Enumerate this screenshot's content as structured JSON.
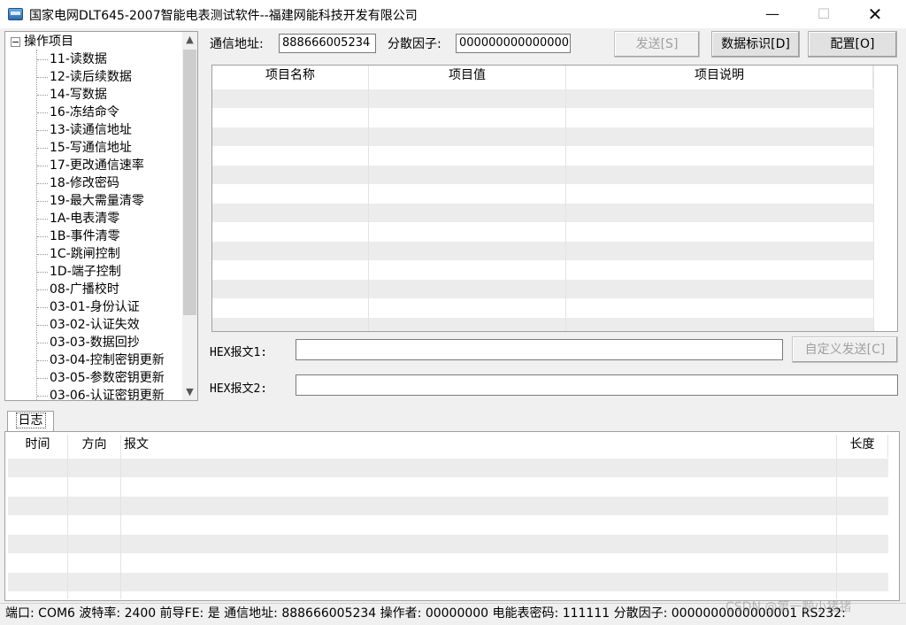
{
  "window": {
    "title": "国家电网DLT645-2007智能电表测试软件--福建网能科技开发有限公司",
    "min_glyph": "—",
    "max_glyph": "☐",
    "close_glyph": "✕"
  },
  "tree": {
    "root_label": "操作项目",
    "items": [
      "11-读数据",
      "12-读后续数据",
      "14-写数据",
      "16-冻结命令",
      "13-读通信地址",
      "15-写通信地址",
      "17-更改通信速率",
      "18-修改密码",
      "19-最大需量清零",
      "1A-电表清零",
      "1B-事件清零",
      "1C-跳闸控制",
      "1D-端子控制",
      "08-广播校时",
      "03-01-身份认证",
      "03-02-认证失效",
      "03-03-数据回抄",
      "03-04-控制密钥更新",
      "03-05-参数密钥更新",
      "03-06-认证密钥更新"
    ]
  },
  "top": {
    "address_label": "通信地址:",
    "address_value": "888666005234",
    "factor_label": "分散因子:",
    "factor_value": "0000000000000001",
    "send_button": "发送[S]",
    "data_id_button": "数据标识[D]",
    "config_button": "配置[O]"
  },
  "item_grid": {
    "columns": [
      "项目名称",
      "项目值",
      "项目说明"
    ]
  },
  "hex": {
    "label1": "HEX报文1:",
    "label2": "HEX报文2:",
    "custom_send_button": "自定义发送[C]",
    "value1": "",
    "value2": ""
  },
  "log": {
    "tab_label": "日志",
    "columns": [
      "时间",
      "方向",
      "报文",
      "长度"
    ]
  },
  "status": {
    "text": "端口: COM6 波特率: 2400 前导FE: 是 通信地址: 888666005234 操作者: 00000000 电能表密码: 111111 分散因子: 0000000000000001 RS232:"
  },
  "watermark": "CSDN @第一颗小猪猪"
}
